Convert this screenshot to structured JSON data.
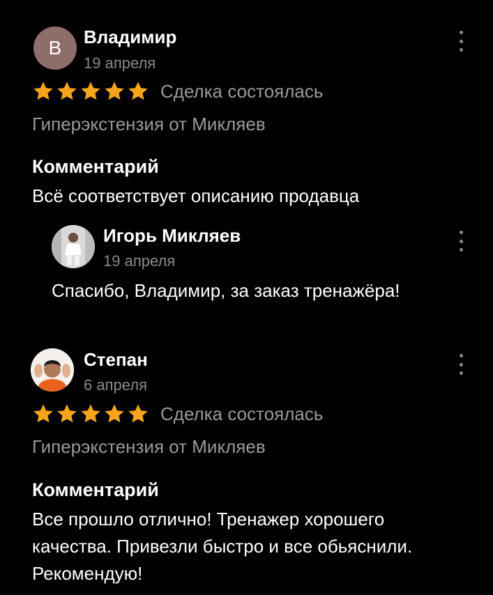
{
  "colors": {
    "background": "#000000",
    "star": "#f7a41d",
    "muted_text": "#9a9a9a",
    "avatar_letter_bg": "#8e6e6a"
  },
  "reviews": [
    {
      "avatar_letter": "В",
      "name": "Владимир",
      "date": "19 апреля",
      "stars": 5,
      "deal_status": "Сделка состоялась",
      "product": "Гиперэкстензия от Микляев",
      "comment_label": "Комментарий",
      "comment": "Всё соответствует описанию продавца",
      "reply": {
        "name": "Игорь Микляев",
        "date": "19 апреля",
        "text": "Спасибо, Владимир,  за заказ тренажёра!"
      }
    },
    {
      "name": "Степан",
      "date": "6 апреля",
      "stars": 5,
      "deal_status": "Сделка состоялась",
      "product": "Гиперэкстензия от Микляев",
      "comment_label": "Комментарий",
      "comment": "Все прошло отлично! Тренажер хорошего качества. Привезли быстро и все обьяснили. Рекомендую!"
    }
  ]
}
